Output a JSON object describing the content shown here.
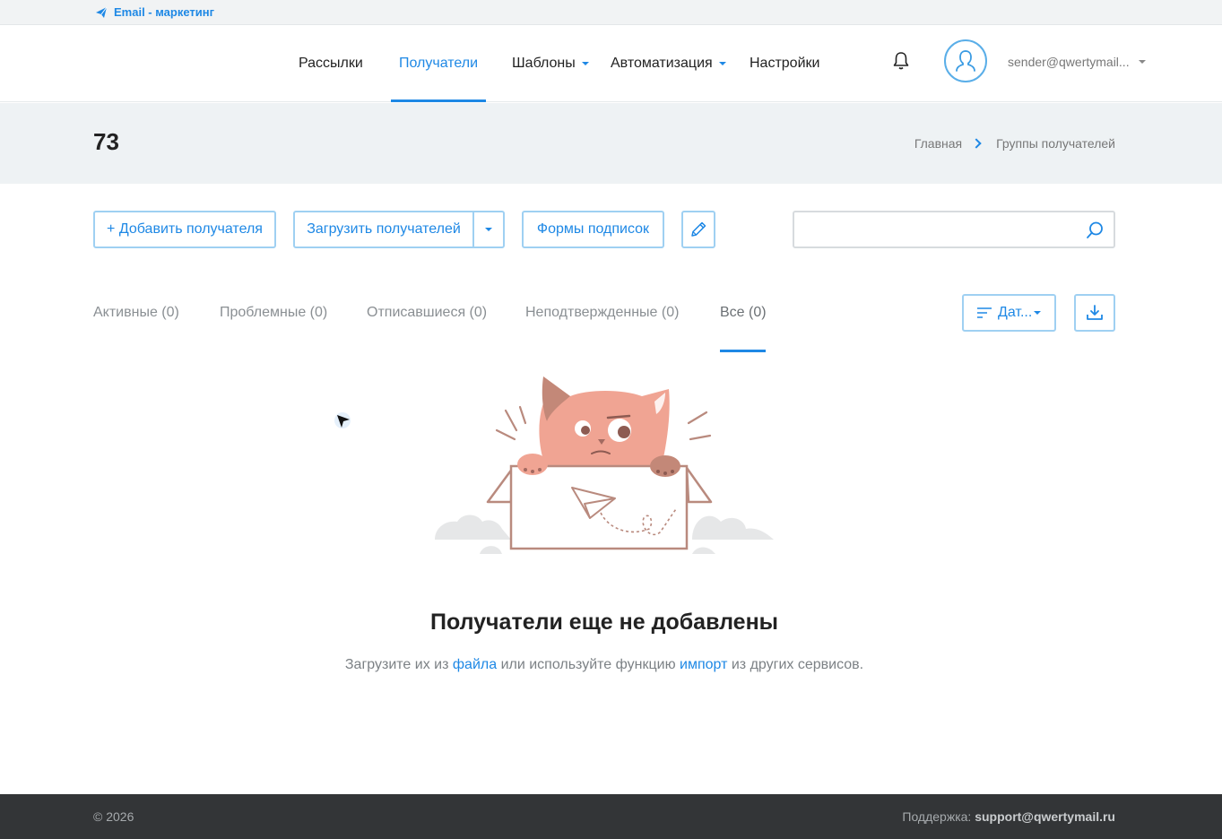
{
  "top_strip": {
    "brand": "Email - маркетинг"
  },
  "nav": {
    "items": [
      {
        "label": "Рассылки"
      },
      {
        "label": "Получатели"
      },
      {
        "label": "Шаблоны"
      },
      {
        "label": "Автоматизация"
      },
      {
        "label": "Настройки"
      }
    ],
    "account": "sender@qwertymail..."
  },
  "page": {
    "title": "73"
  },
  "breadcrumb": {
    "home": "Главная",
    "current": "Группы получателей"
  },
  "toolbar": {
    "add_recipient": "+ Добавить получателя",
    "upload_recipients": "Загрузить получателей",
    "subscription_forms": "Формы подписок",
    "search_value": ""
  },
  "tabs": [
    {
      "label": "Активные (0)"
    },
    {
      "label": "Проблемные (0)"
    },
    {
      "label": "Отписавшиеся (0)"
    },
    {
      "label": "Неподтвержденные (0)"
    },
    {
      "label": "Все (0)"
    }
  ],
  "sort": {
    "label": "Дат..."
  },
  "empty_state": {
    "title": "Получатели еще не добавлены",
    "text_before": "Загрузите их из",
    "link_file": "файла",
    "text_middle": "или используйте функцию",
    "link_import": "импорт",
    "text_after": "из других сервисов."
  },
  "footer": {
    "copyright": "© 2026",
    "support_label": "Поддержка:",
    "support_email": "support@qwertymail.ru"
  },
  "colors": {
    "accent": "#1e88e5",
    "footer_bg": "#333537",
    "band_bg": "#eef2f4"
  }
}
